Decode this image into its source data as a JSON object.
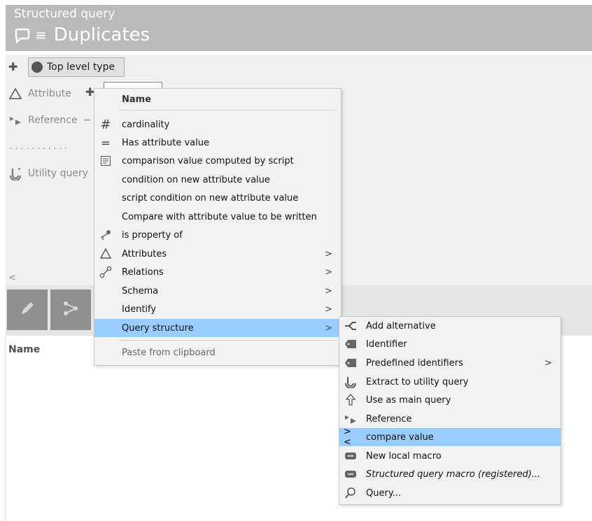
{
  "header": {
    "subtitle": "Structured query",
    "title": "Duplicates"
  },
  "tree": {
    "top_level_button": "Top level type",
    "rows": [
      {
        "label": "Attribute"
      },
      {
        "label": "Reference"
      },
      {
        "label": "Utility query"
      }
    ],
    "dots": "...........",
    "scroll_left": "<"
  },
  "lower_panel": {
    "name_header": "Name"
  },
  "context_menu": {
    "header": "Name",
    "items": [
      {
        "label": "cardinality",
        "icon": "hash-icon"
      },
      {
        "label": "Has attribute value",
        "icon": "equals-icon"
      },
      {
        "label": "comparison value computed by script",
        "icon": "script-icon"
      },
      {
        "label": "condition on new attribute value",
        "icon": ""
      },
      {
        "label": "script condition on new attribute value",
        "icon": ""
      },
      {
        "label": "Compare with attribute value to be written",
        "icon": ""
      },
      {
        "label": "is property of",
        "icon": "property-icon"
      },
      {
        "label": "Attributes",
        "icon": "triangle-icon",
        "submenu": ">"
      },
      {
        "label": "Relations",
        "icon": "relation-icon",
        "submenu": ">"
      },
      {
        "label": "Schema",
        "icon": "",
        "submenu": ">"
      },
      {
        "label": "Identify",
        "icon": "",
        "submenu": ">"
      },
      {
        "label": "Query structure",
        "icon": "",
        "submenu": ">",
        "highlighted": true
      },
      {
        "label": "Paste from clipboard",
        "icon": "",
        "disabled": true
      }
    ]
  },
  "submenu": {
    "items": [
      {
        "label": "Add alternative",
        "icon": "alternative-icon"
      },
      {
        "label": "Identifier",
        "icon": "tag-icon"
      },
      {
        "label": "Predefined identifiers",
        "icon": "tag-icon",
        "submenu": ">"
      },
      {
        "label": "Extract to utility query",
        "icon": "anchor-icon"
      },
      {
        "label": "Use as main query",
        "icon": "upload-icon"
      },
      {
        "label": "Reference",
        "icon": "reference-icon"
      },
      {
        "label": "compare value",
        "icon": "compare-icon",
        "highlighted": true
      },
      {
        "label": "New local macro",
        "icon": "macro-icon"
      },
      {
        "label": "Structured query macro (registered)...",
        "icon": "macro-icon",
        "italic": true
      },
      {
        "label": "Query...",
        "icon": "search-icon"
      }
    ]
  },
  "colors": {
    "highlight": "#99ccff",
    "header_bg": "#bababa",
    "toolbar_button": "#8f8f8f"
  }
}
